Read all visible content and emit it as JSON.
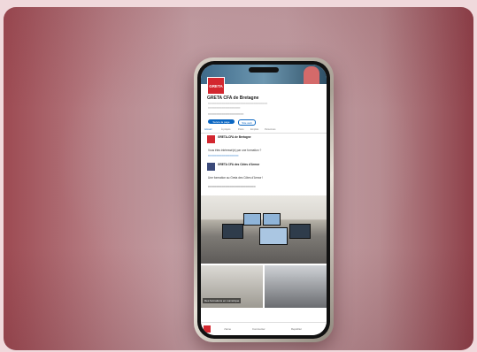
{
  "org": {
    "name": "GRETA CFA de Bretagne",
    "logo_text": "GRETA",
    "follow_label": "Suivre la page",
    "visit_label": "Site web"
  },
  "tabs": [
    "Accueil",
    "À propos",
    "Posts",
    "Emplois",
    "Personnes"
  ],
  "posts": [
    {
      "author": "GRETA-CFA de Bretagne",
      "text": "Vous êtes intéressé(e) par une formation ?"
    },
    {
      "author": "GRETA CFA des Côtes d'Armor",
      "text": "Une formation au Greta des Côtes d'Armor !"
    }
  ],
  "photo_caption": "Des formations en numérique",
  "bottom_nav": [
    "J'aime",
    "Commenter",
    "Republier"
  ]
}
